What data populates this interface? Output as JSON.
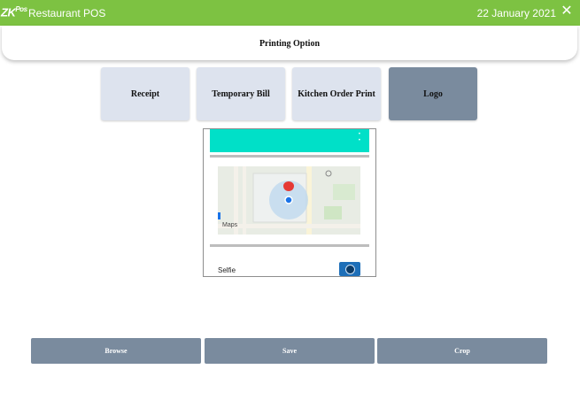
{
  "titlebar": {
    "brand": "ZK",
    "brand_suffix": "Pos",
    "app_title": "Restaurant POS",
    "date": "22 January 2021",
    "close_glyph": "✕"
  },
  "header": {
    "title": "Printing Option"
  },
  "tabs": [
    {
      "label": "Receipt",
      "active": false
    },
    {
      "label": "Temporary Bill",
      "active": false
    },
    {
      "label": "Kitchen Order Print",
      "active": false
    },
    {
      "label": "Logo",
      "active": true
    }
  ],
  "preview": {
    "map_label": "Maps",
    "selfie_label": "Selfie"
  },
  "actions": {
    "browse": "Browse",
    "save": "Save",
    "crop": "Crop"
  },
  "colors": {
    "title_green": "#7dc242",
    "button_slate": "#7a8b9e",
    "tab_light": "#dde3ee",
    "teal": "#00e0c8"
  }
}
